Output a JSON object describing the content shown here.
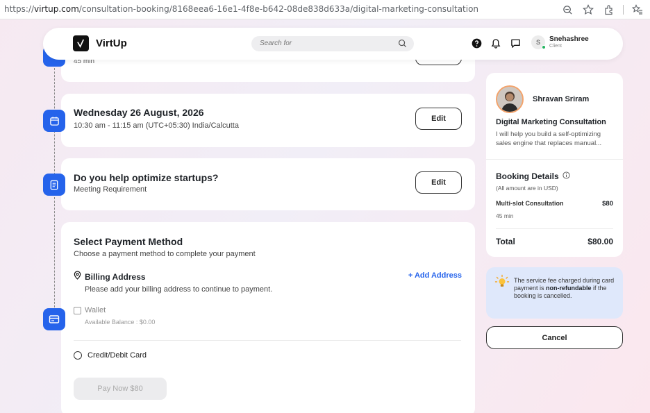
{
  "browser": {
    "url_prefix": "https://",
    "url_host": "virtup.com",
    "url_path": "/consultation-booking/8168eea6-16e1-4f8e-b642-08de838d633a/digital-marketing-consultation"
  },
  "header": {
    "logo_text": "VirtUp",
    "search_placeholder": "Search for",
    "user_initial": "S",
    "user_name": "Snehashree",
    "user_role": "Client"
  },
  "top_card": {
    "duration": "45 min"
  },
  "schedule_card": {
    "title": "Wednesday 26 August, 2026",
    "subtitle": "10:30 am - 11:15 am (UTC+05:30) India/Calcutta",
    "edit_label": "Edit"
  },
  "requirement_card": {
    "title": "Do you help optimize startups?",
    "subtitle": "Meeting Requirement",
    "edit_label": "Edit"
  },
  "payment": {
    "title": "Select Payment Method",
    "subtitle": "Choose a payment method to complete your payment",
    "billing_title": "Billing Address",
    "add_address": "+ Add Address",
    "billing_sub": "Please add your billing address to continue to payment.",
    "wallet_label": "Wallet",
    "wallet_balance": "Available Balance : $0.00",
    "card_label": "Credit/Debit Card",
    "pay_label": "Pay Now $80"
  },
  "summary": {
    "consultant_name": "Shravan Sriram",
    "service_title": "Digital Marketing Consultation",
    "service_desc": "I will help you build a self-optimizing sales engine that replaces manual...",
    "booking_title": "Booking Details",
    "booking_note": "(All amount are in USD)",
    "item_name": "Multi-slot Consultation",
    "item_price": "$80",
    "item_duration": "45 min",
    "total_label": "Total",
    "total_value": "$80.00"
  },
  "notice": {
    "text_before": "The service fee charged during card payment is ",
    "text_bold": "non-refundable",
    "text_after": " if the booking is cancelled."
  },
  "cancel_label": "Cancel",
  "colors": {
    "accent": "#2563eb",
    "notice_bg": "#dfe8fb",
    "online": "#22b35e"
  }
}
